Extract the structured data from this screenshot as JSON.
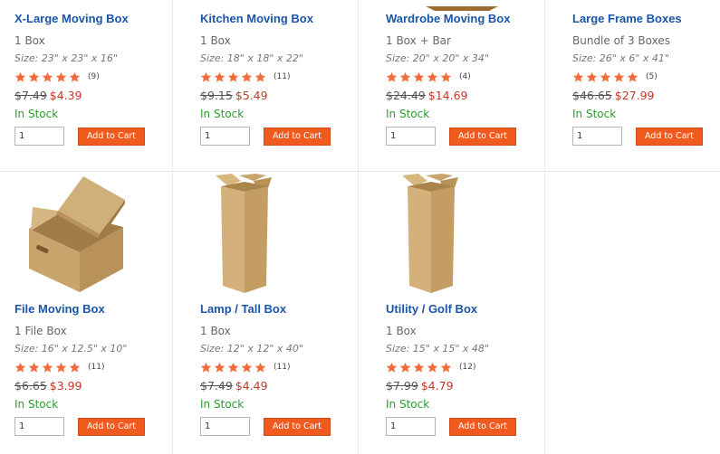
{
  "colors": {
    "title_link": "#1a55a8",
    "sale_price": "#c0392b",
    "in_stock": "#2d9a2d",
    "star": "#f26b3a",
    "button_bg": "#f05a1e"
  },
  "products": [
    {
      "name": "X-Large Moving Box",
      "qty": "1 Box",
      "size": "Size: 23\" x 23\" x 16\"",
      "rating": 5,
      "reviews": "(9)",
      "old_price": "$7.49",
      "price": "$4.39",
      "stock": "In Stock",
      "quantity": "1",
      "add_to_cart": "Add to Cart"
    },
    {
      "name": "Kitchen Moving Box",
      "qty": "1 Box",
      "size": "Size: 18\" x 18\" x 22\"",
      "rating": 5,
      "reviews": "(11)",
      "old_price": "$9.15",
      "price": "$5.49",
      "stock": "In Stock",
      "quantity": "1",
      "add_to_cart": "Add to Cart"
    },
    {
      "name": "Wardrobe Moving Box",
      "qty": "1 Box + Bar",
      "size": "Size: 20\" x 20\" x 34\"",
      "rating": 5,
      "reviews": "(4)",
      "old_price": "$24.49",
      "price": "$14.69",
      "stock": "In Stock",
      "quantity": "1",
      "add_to_cart": "Add to Cart"
    },
    {
      "name": "Large Frame Boxes",
      "qty": "Bundle of 3 Boxes",
      "size": "Size: 26\" x 6\" x 41\"",
      "rating": 5,
      "reviews": "(5)",
      "old_price": "$46.65",
      "price": "$27.99",
      "stock": "In Stock",
      "quantity": "1",
      "add_to_cart": "Add to Cart"
    },
    {
      "name": "File Moving Box",
      "qty": "1 File Box",
      "size": "Size: 16\" x 12.5\" x 10\"",
      "rating": 5,
      "reviews": "(11)",
      "old_price": "$6.65",
      "price": "$3.99",
      "stock": "In Stock",
      "quantity": "1",
      "add_to_cart": "Add to Cart"
    },
    {
      "name": "Lamp / Tall Box",
      "qty": "1 Box",
      "size": "Size: 12\" x 12\" x 40\"",
      "rating": 5,
      "reviews": "(11)",
      "old_price": "$7.49",
      "price": "$4.49",
      "stock": "In Stock",
      "quantity": "1",
      "add_to_cart": "Add to Cart"
    },
    {
      "name": "Utility / Golf Box",
      "qty": "1 Box",
      "size": "Size: 15\" x 15\" x 48\"",
      "rating": 5,
      "reviews": "(12)",
      "old_price": "$7.99",
      "price": "$4.79",
      "stock": "In Stock",
      "quantity": "1",
      "add_to_cart": "Add to Cart"
    }
  ]
}
